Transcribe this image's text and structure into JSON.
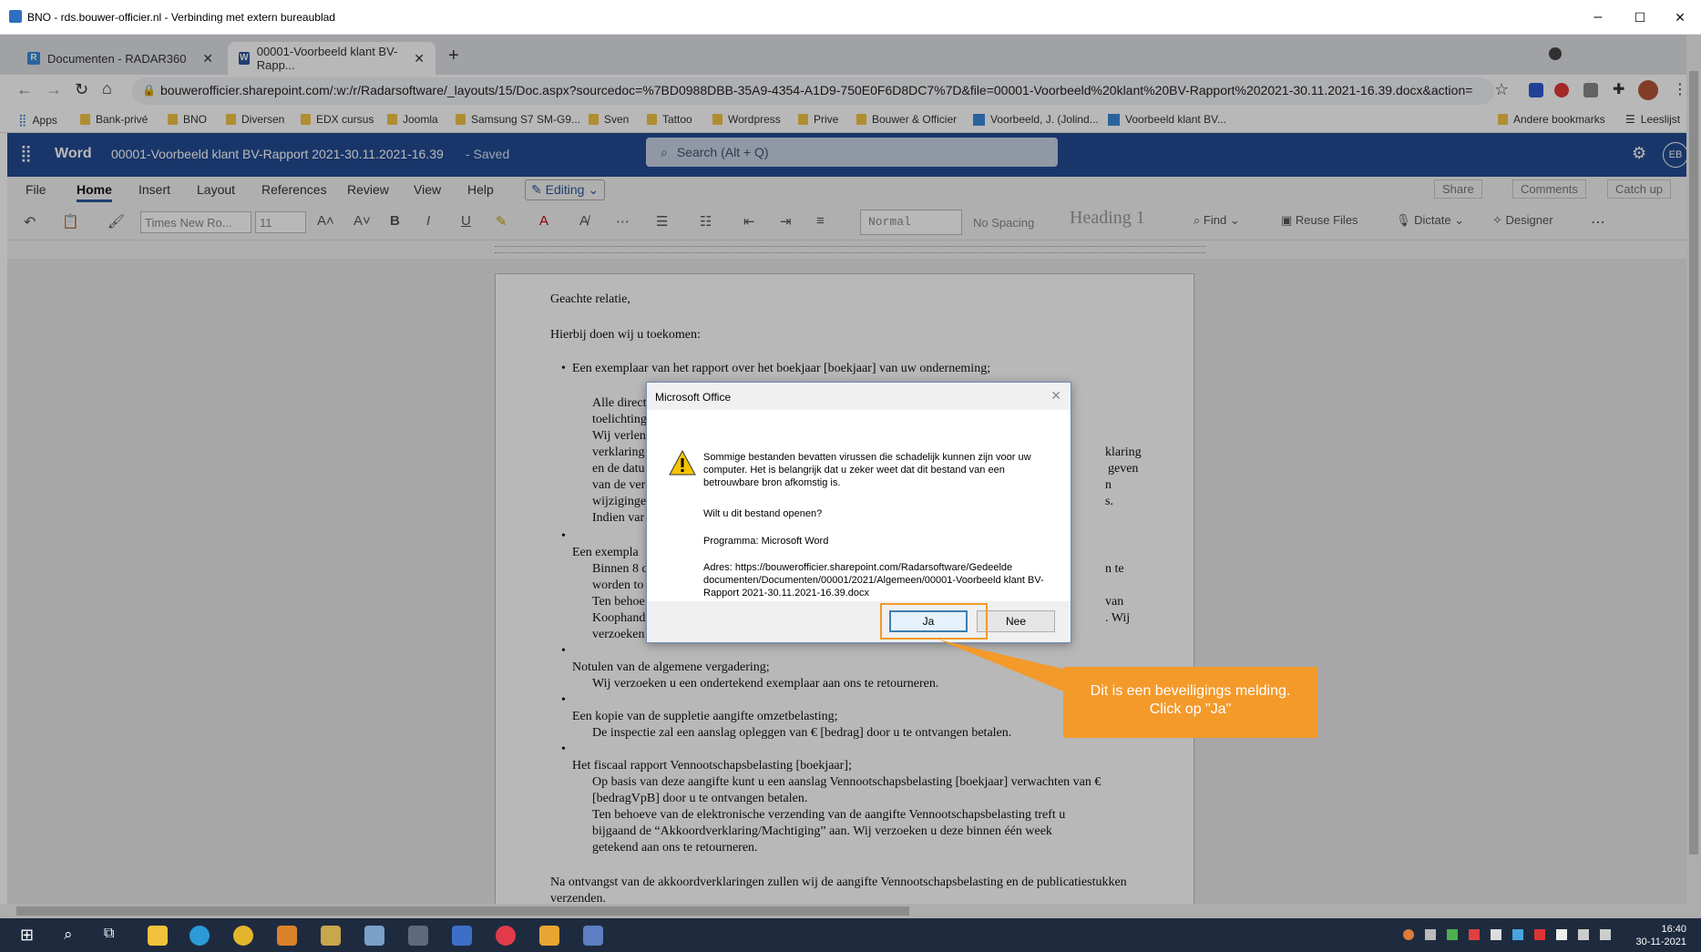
{
  "rdp": {
    "title": "BNO - rds.bouwer-officier.nl - Verbinding met extern bureaublad",
    "minimize": "–",
    "maximize": "☐",
    "close": "✕"
  },
  "browser": {
    "tabs": [
      {
        "label": "Documenten - RADAR360",
        "icon": "radar-icon"
      },
      {
        "label": "00001-Voorbeeld klant BV-Rapp...",
        "icon": "word-icon"
      }
    ],
    "url": "bouwerofficier.sharepoint.com/:w:/r/Radarsoftware/_layouts/15/Doc.aspx?sourcedoc=%7BD0988DBB-35A9-4354-A1D9-750E0F6D8DC7%7D&file=00001-Voorbeeld%20klant%20BV-Rapport%202021-30.11.2021-16.39.docx&action=default&...",
    "bookmarks": [
      "Apps",
      "Bank-privé",
      "BNO",
      "Diversen",
      "EDX cursus",
      "Joomla",
      "Samsung S7 SM-G9...",
      "Sven",
      "Tattoo",
      "Wordpress",
      "Prive",
      "Bouwer & Officier",
      "Voorbeeld, J. (Jolind...",
      "Voorbeeld klant BV..."
    ],
    "bookmarks_right": [
      "Andere bookmarks",
      "Leeslijst"
    ]
  },
  "word": {
    "app_name": "Word",
    "doc_title": "00001-Voorbeeld klant BV-Rapport 2021-30.11.2021-16.39",
    "saved": "- Saved",
    "search_placeholder": "Search (Alt + Q)",
    "avatar": "EB",
    "menu": [
      "File",
      "Home",
      "Insert",
      "Layout",
      "References",
      "Review",
      "View",
      "Help"
    ],
    "editing": "Editing",
    "share": "Share",
    "comments": "Comments",
    "catchup": "Catch up",
    "font_name": "Times New Ro...",
    "font_size": "11",
    "styles": [
      "Normal",
      "No Spacing",
      "Heading 1"
    ],
    "find": "Find",
    "reuse": "Reuse Files",
    "dictate": "Dictate",
    "designer": "Designer"
  },
  "document": {
    "lines": [
      "Geachte relatie,",
      "Hierbij doen wij u toekomen:",
      "Een exemplaar van het rapport over het boekjaar [boekjaar] van uw onderneming;",
      "Alle direct",
      "toelichting",
      "Wij verlen",
      "verklaring",
      "en de datu",
      "van de ver",
      "wijziginge",
      "Indien var",
      "Een exempla",
      "Binnen 8 d",
      "worden to",
      "Ten behoe",
      "Koophand",
      "verzoeken",
      "Notulen van de algemene vergadering;",
      "Wij verzoeken u een ondertekend exemplaar aan ons te retourneren.",
      "Een kopie van de suppletie aangifte omzetbelasting;",
      "De inspectie zal een aanslag opleggen van € [bedrag] door u te ontvangen betalen.",
      "Het fiscaal rapport Vennootschapsbelasting [boekjaar];",
      "Op basis van deze aangifte kunt u een aanslag Vennootschapsbelasting [boekjaar] verwachten van €",
      "[bedragVpB] door u te ontvangen betalen.",
      "Ten behoeve van de elektronische verzending van de aangifte Vennootschapsbelasting treft u",
      "bijgaand de “Akkoordverklaring/Machtiging” aan. Wij verzoeken u deze binnen één week",
      "getekend aan ons te retourneren.",
      "Na ontvangst van de akkoordverklaringen zullen wij de aangifte Vennootschapsbelasting en de publicatiestukken",
      "verzenden."
    ],
    "right_fragments": [
      "klaring",
      "geven",
      "n",
      "s.",
      "n te",
      "van",
      ". Wij"
    ]
  },
  "dialog": {
    "title": "Microsoft Office",
    "message": "Sommige bestanden bevatten virussen die schadelijk kunnen zijn voor uw computer. Het is belangrijk dat u zeker weet dat dit bestand van een betrouwbare bron afkomstig is.",
    "question": "Wilt u dit bestand openen?",
    "program": "Programma: Microsoft Word",
    "address": "Adres: https://bouwerofficier.sharepoint.com/Radarsoftware/Gedeelde documenten/Documenten/00001/2021/Algemeen/00001-Voorbeeld klant BV-Rapport 2021-30.11.2021-16.39.docx",
    "yes": "Ja",
    "no": "Nee"
  },
  "callout": {
    "line1": "Dit is een beveiligings melding.",
    "line2": "Click op \"Ja\""
  },
  "taskbar": {
    "time": "16:40",
    "date": "30-11-2021"
  },
  "colors": {
    "word_blue": "#234b94",
    "callout_orange": "#f39a2b"
  }
}
